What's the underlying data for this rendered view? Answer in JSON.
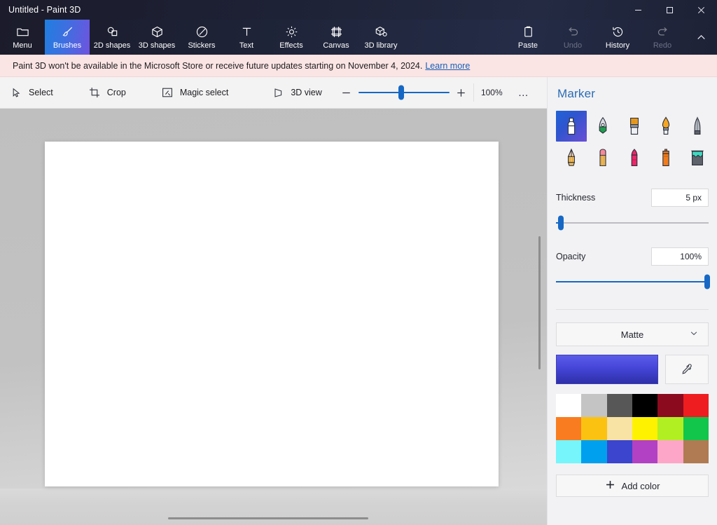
{
  "window": {
    "title": "Untitled - Paint 3D",
    "controls": [
      {
        "name": "minimize",
        "label": "–"
      },
      {
        "name": "maximize",
        "label": "□"
      },
      {
        "name": "close",
        "label": "✕"
      }
    ]
  },
  "ribbon": {
    "items": [
      {
        "label": "Menu",
        "icon": "folder-icon",
        "state": "normal"
      },
      {
        "label": "Brushes",
        "icon": "brush-icon",
        "state": "active"
      },
      {
        "label": "2D shapes",
        "icon": "2d-shapes-icon",
        "state": "normal"
      },
      {
        "label": "3D shapes",
        "icon": "3d-shapes-icon",
        "state": "normal"
      },
      {
        "label": "Stickers",
        "icon": "sticker-icon",
        "state": "normal"
      },
      {
        "label": "Text",
        "icon": "text-icon",
        "state": "normal"
      },
      {
        "label": "Effects",
        "icon": "effects-icon",
        "state": "normal"
      },
      {
        "label": "Canvas",
        "icon": "canvas-icon",
        "state": "normal"
      },
      {
        "label": "3D library",
        "icon": "3d-library-icon",
        "state": "normal"
      }
    ],
    "right_items": [
      {
        "label": "Paste",
        "icon": "paste-icon",
        "state": "normal"
      },
      {
        "label": "Undo",
        "icon": "undo-icon",
        "state": "disabled"
      },
      {
        "label": "History",
        "icon": "history-icon",
        "state": "normal"
      },
      {
        "label": "Redo",
        "icon": "redo-icon",
        "state": "disabled"
      }
    ],
    "collapse_icon": "chevron-up-icon"
  },
  "banner": {
    "message": "Paint 3D won't be available in the Microsoft Store or receive future updates starting on November 4, 2024.",
    "link_label": "Learn more",
    "background": "#fbe4e4",
    "link_color": "#1660b8"
  },
  "toolbar": {
    "buttons": [
      {
        "label": "Select",
        "icon": "cursor-arrow-icon"
      },
      {
        "label": "Crop",
        "icon": "crop-icon"
      },
      {
        "label": "Magic select",
        "icon": "magic-select-icon"
      },
      {
        "label": "3D view",
        "icon": "3d-view-icon"
      }
    ],
    "zoom": {
      "minus_label": "–",
      "plus_label": "+",
      "percent": "100%",
      "value": 47,
      "more_label": "…"
    }
  },
  "sidebar": {
    "title": "Marker",
    "tools": [
      {
        "name": "marker",
        "selected": true
      },
      {
        "name": "calligraphy-pen",
        "selected": false
      },
      {
        "name": "oil-brush",
        "selected": false
      },
      {
        "name": "watercolor",
        "selected": false
      },
      {
        "name": "pixel-pen",
        "selected": false
      },
      {
        "name": "pencil",
        "selected": false
      },
      {
        "name": "eraser",
        "selected": false
      },
      {
        "name": "crayon",
        "selected": false
      },
      {
        "name": "spray-can",
        "selected": false
      },
      {
        "name": "fill",
        "selected": false
      }
    ],
    "thickness": {
      "label": "Thickness",
      "value": "5 px",
      "slider_percent": 3
    },
    "opacity": {
      "label": "Opacity",
      "value": "100%",
      "slider_percent": 99
    },
    "material": {
      "label": "Matte",
      "chevron": "chevron-down-icon"
    },
    "current_color": "#4747da",
    "eyedropper_icon": "eyedropper-icon",
    "swatches": [
      "#ffffff",
      "#c4c4c4",
      "#575757",
      "#000000",
      "#8b0a1e",
      "#ee1d20",
      "#f97d20",
      "#fcc211",
      "#f8e2a4",
      "#fef200",
      "#b2ef22",
      "#11c64b",
      "#76f5fb",
      "#00a0ee",
      "#3b45cd",
      "#b341c4",
      "#fda6c7",
      "#b07b52"
    ],
    "add_color": {
      "label": "Add color",
      "icon": "plus-icon"
    }
  },
  "canvas": {
    "paper_color": "#ffffff",
    "stage_color": "#c2c2c2"
  }
}
